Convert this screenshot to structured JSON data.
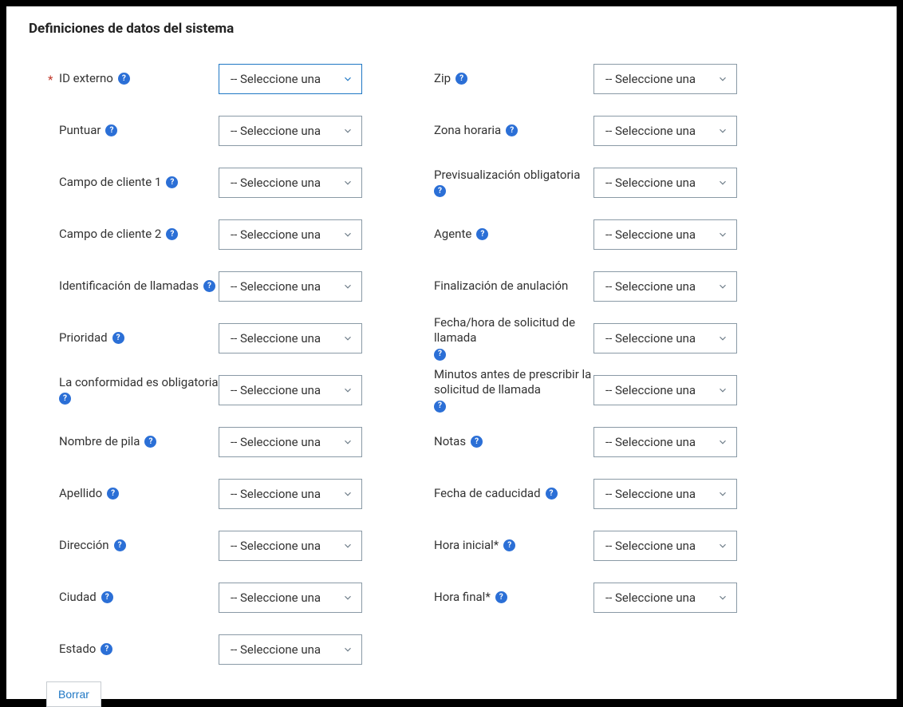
{
  "title": "Definiciones de datos del sistema",
  "select_placeholder": "-- Seleccione una",
  "clear_label": "Borrar",
  "left": [
    {
      "name": "id-externo",
      "label": "ID externo",
      "required": true,
      "help": true,
      "focused": true
    },
    {
      "name": "puntuar",
      "label": "Puntuar",
      "required": false,
      "help": true
    },
    {
      "name": "campo-cliente-1",
      "label": "Campo de cliente 1",
      "required": false,
      "help": true
    },
    {
      "name": "campo-cliente-2",
      "label": "Campo de cliente 2",
      "required": false,
      "help": true
    },
    {
      "name": "identificacion-llamadas",
      "label": "Identificación de llamadas",
      "required": false,
      "help": true
    },
    {
      "name": "prioridad",
      "label": "Prioridad",
      "required": false,
      "help": true
    },
    {
      "name": "conformidad-obligatoria",
      "label": "La conformidad es obligatoria",
      "required": false,
      "help": true
    },
    {
      "name": "nombre-pila",
      "label": "Nombre de pila",
      "required": false,
      "help": true
    },
    {
      "name": "apellido",
      "label": "Apellido",
      "required": false,
      "help": true
    },
    {
      "name": "direccion",
      "label": "Dirección",
      "required": false,
      "help": true
    },
    {
      "name": "ciudad",
      "label": "Ciudad",
      "required": false,
      "help": true
    },
    {
      "name": "estado",
      "label": "Estado",
      "required": false,
      "help": true
    }
  ],
  "right": [
    {
      "name": "zip",
      "label": "Zip",
      "required": false,
      "help": true
    },
    {
      "name": "zona-horaria",
      "label": "Zona horaria",
      "required": false,
      "help": true
    },
    {
      "name": "previsualizacion-obligatoria",
      "label": "Previsualización obligatoria",
      "required": false,
      "help": true
    },
    {
      "name": "agente",
      "label": "Agente",
      "required": false,
      "help": true
    },
    {
      "name": "finalizacion-anulacion",
      "label": "Finalización de anulación",
      "required": false,
      "help": false
    },
    {
      "name": "fecha-hora-solicitud-llamada",
      "label": "Fecha/hora de solicitud de llamada",
      "required": false,
      "help": true
    },
    {
      "name": "minutos-prescribir-solicitud",
      "label": "Minutos antes de prescribir la solicitud de llamada",
      "required": false,
      "help": true
    },
    {
      "name": "notas",
      "label": "Notas",
      "required": false,
      "help": true
    },
    {
      "name": "fecha-caducidad",
      "label": "Fecha de caducidad",
      "required": false,
      "help": true
    },
    {
      "name": "hora-inicial",
      "label": "Hora inicial*",
      "required": false,
      "help": true
    },
    {
      "name": "hora-final",
      "label": "Hora final*",
      "required": false,
      "help": true
    }
  ]
}
